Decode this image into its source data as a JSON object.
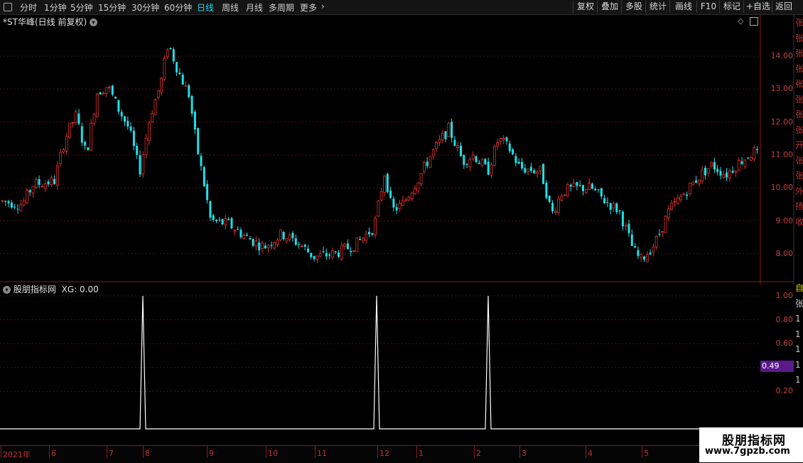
{
  "toolbar": {
    "left_icon": "window-icon",
    "periods": [
      "分时",
      "1分钟",
      "5分钟",
      "15分钟",
      "30分钟",
      "60分钟",
      "日线",
      "周线",
      "月线",
      "多周期",
      "更多"
    ],
    "active_period": "日线",
    "right_buttons": [
      "复权",
      "叠加",
      "多股",
      "统计",
      "画线",
      "F10",
      "标记",
      "+自选",
      "返回"
    ]
  },
  "main_chart": {
    "title": "*ST华峰(日线 前复权)",
    "price_ticks": [
      "14.00",
      "13.00",
      "12.00",
      "11.00",
      "10.00",
      "9.00",
      "8.00"
    ]
  },
  "indicator": {
    "title": "股朋指标网",
    "xg_label": "XG: 0.00",
    "ticks": [
      "1.00",
      "0.80",
      "0.60",
      "0.40",
      "0.20"
    ],
    "current_value": "0.49"
  },
  "date_axis": [
    "2021年",
    "6",
    "7",
    "8",
    "9",
    "10",
    "11",
    "12",
    "1",
    "2",
    "3",
    "4",
    "5"
  ],
  "right_panel_chars": [
    "张",
    "张",
    "张",
    "张",
    "张",
    "张",
    "张",
    "张",
    "开",
    "张",
    "张",
    "外",
    "扬",
    "收"
  ],
  "right_panel_lower": [
    "自",
    "张",
    "1",
    "1",
    "1",
    "1",
    "1"
  ],
  "watermark": {
    "title": "股朋指标网",
    "url": "www.7gpzb.com"
  },
  "colors": {
    "up": "#e03030",
    "down": "#20e0e8",
    "accent": "#1fd6e6",
    "value_box": "#5a1a8a"
  },
  "chart_data": {
    "type": "candlestick",
    "price_ylim": [
      7.2,
      15.0
    ],
    "indicator_ylim": [
      0,
      1.05
    ],
    "signal_spikes": [
      {
        "near": "8",
        "value": 1.0
      },
      {
        "near": "12",
        "value": 1.0
      },
      {
        "near": "2",
        "value": 1.0
      }
    ]
  }
}
